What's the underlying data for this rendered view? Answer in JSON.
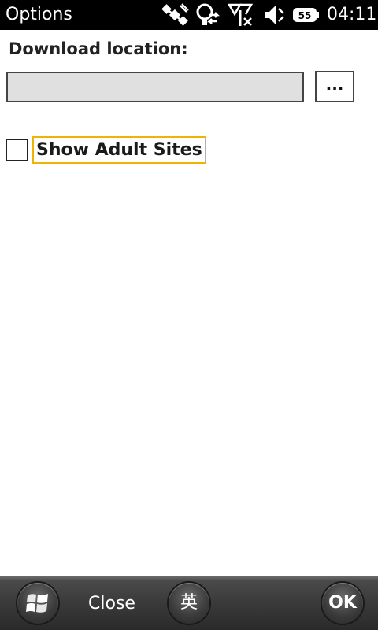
{
  "status_bar": {
    "app_title": "Options",
    "time": "04:11",
    "icons": [
      "satellite-icon",
      "sync-connection-icon",
      "no-signal-icon",
      "speaker-icon",
      "battery-icon"
    ],
    "battery_label": "55"
  },
  "form": {
    "download_label": "Download location:",
    "download_value": "",
    "browse_label": "...",
    "show_adult_label": "Show Adult Sites",
    "show_adult_checked": false,
    "focus_color": "#f0b400"
  },
  "menu_bar": {
    "start_icon": "windows-flag-icon",
    "close_label": "Close",
    "ime_label": "英",
    "ok_label": "OK"
  }
}
